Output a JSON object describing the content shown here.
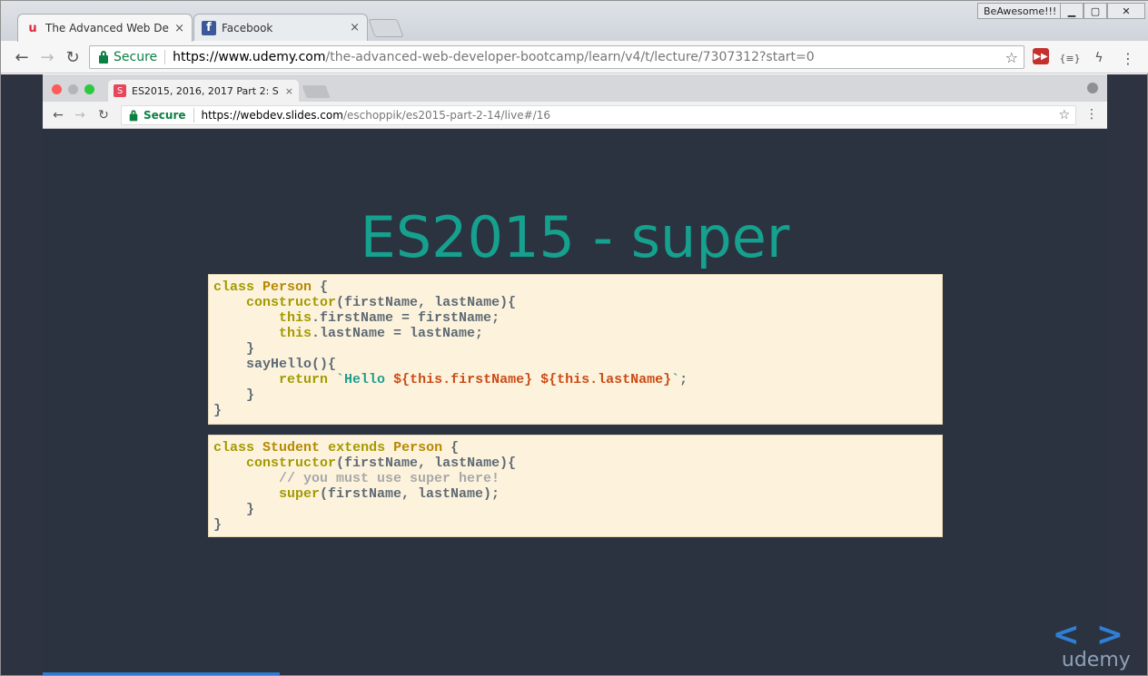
{
  "outer_browser": {
    "tabs": [
      {
        "title": "The Advanced Web Deve",
        "favicon": "udemy-icon",
        "active": true
      },
      {
        "title": "Facebook",
        "favicon": "facebook-icon",
        "active": false
      }
    ],
    "profile_name": "BeAwesome!!!",
    "secure_label": "Secure",
    "url_host": "https://www.udemy.com",
    "url_path": "/the-advanced-web-developer-bootcamp/learn/v4/t/lecture/7307312?start=0"
  },
  "inner_browser": {
    "tab_title": "ES2015, 2016, 2017 Part 2: S",
    "tab_favicon_letter": "S",
    "secure_label": "Secure",
    "url_host": "https://webdev.slides.com",
    "url_path": "/eschoppik/es2015-part-2-14/live#/16"
  },
  "slide": {
    "title": "ES2015 - super",
    "code_block_1": [
      "class Person {",
      "    constructor(firstName, lastName){",
      "        this.firstName = firstName;",
      "        this.lastName = lastName;",
      "    }",
      "    sayHello(){",
      "        return `Hello ${this.firstName} ${this.lastName}`;",
      "    }",
      "}"
    ],
    "code_block_2": [
      "class Student extends Person {",
      "    constructor(firstName, lastName){",
      "        // you must use super here!",
      "        super(firstName, lastName);",
      "    }",
      "}"
    ]
  },
  "watermark": {
    "brand": "udemy"
  },
  "colors": {
    "title": "#16a08e",
    "slide_bg": "#2b3340",
    "code_bg": "#fdf3dd",
    "secure": "#0b8043"
  }
}
